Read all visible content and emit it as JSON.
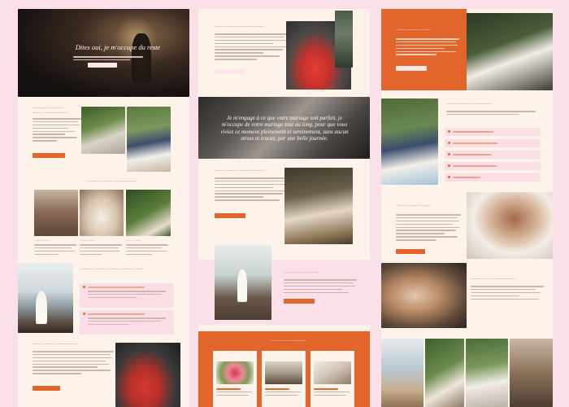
{
  "hero": {
    "title": "Dites oui, je m'occupe du reste"
  },
  "quote": {
    "text": "Je m'engage à ce que votre mariage soit parfait, je m'occupe de votre mariage tout au long, pour que vous viviez ce moment pleinement et sereinement, sans aucun stress ni tracas, par une belle journée."
  }
}
